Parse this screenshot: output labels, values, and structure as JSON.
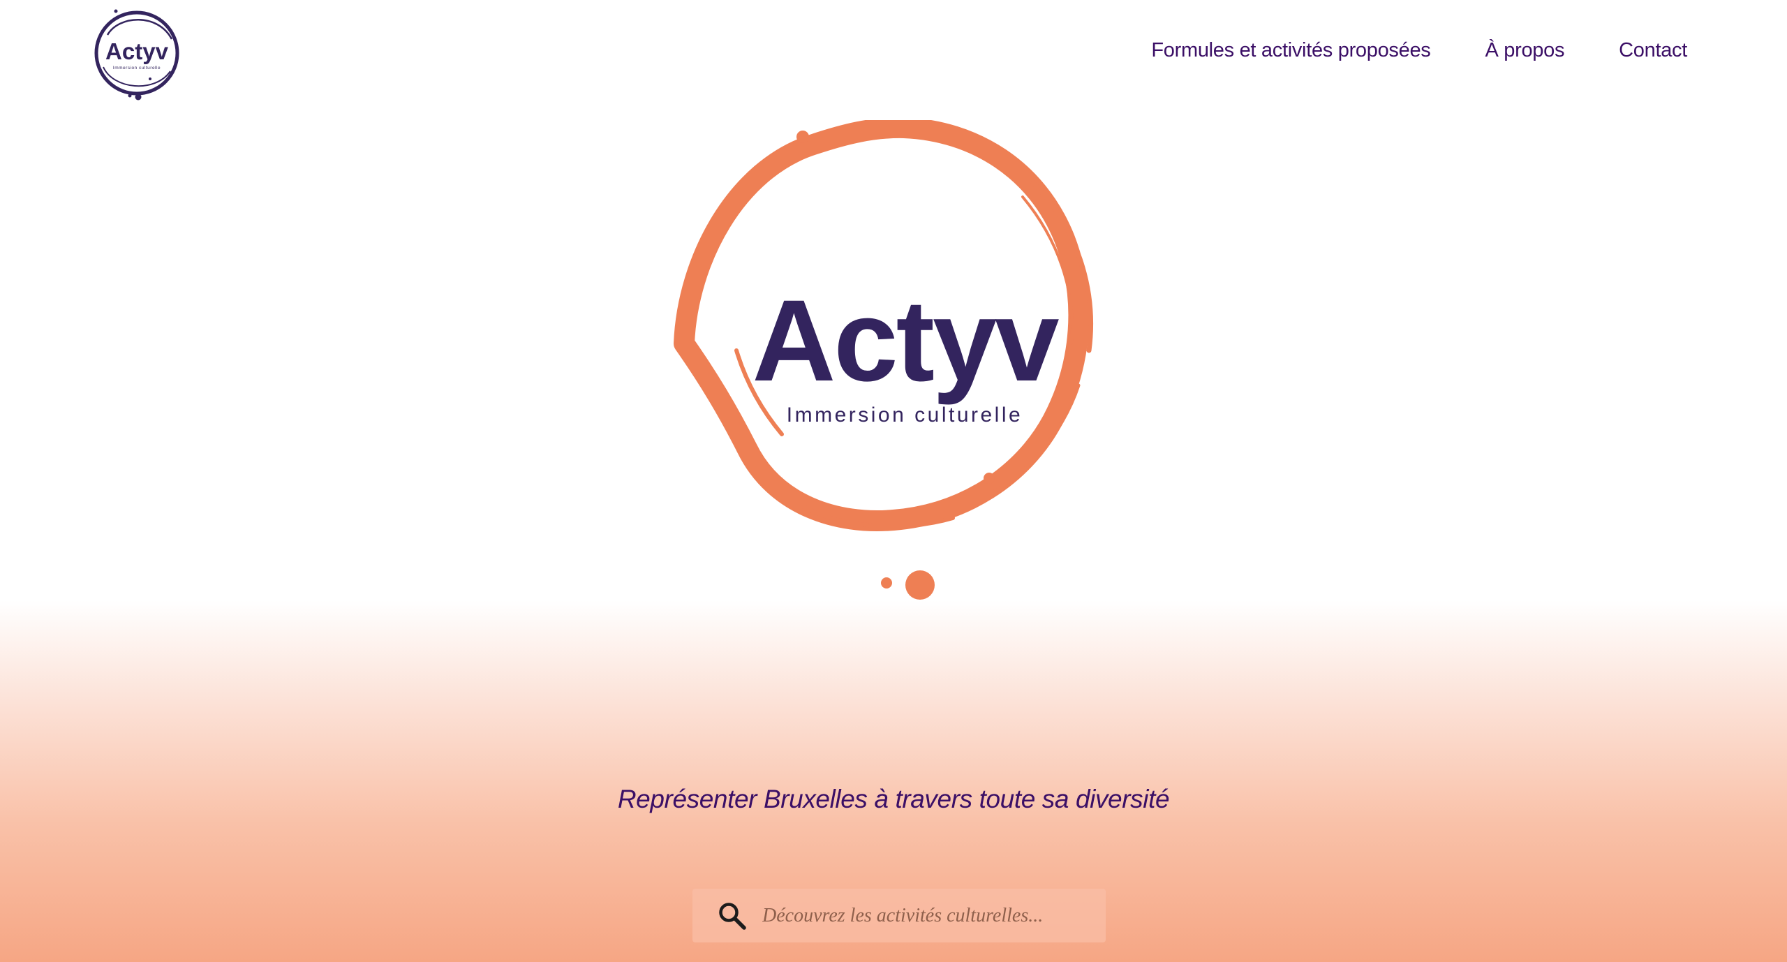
{
  "brand": {
    "logo_wordmark": "Actyv",
    "logo_subtitle": "Immersion culturelle",
    "logo_icon": "actyv-logo",
    "colors": {
      "primary": "#3b0f66",
      "logo_ink": "#33245e",
      "accent": "#ee7f54",
      "gradient_bottom": "#f6a684"
    }
  },
  "nav": {
    "items": [
      {
        "label": "Formules et activités proposées"
      },
      {
        "label": "À propos"
      },
      {
        "label": "Contact"
      }
    ]
  },
  "hero": {
    "tagline": "Représenter Bruxelles à travers toute sa diversité"
  },
  "search": {
    "icon": "search-icon",
    "placeholder": "Découvrez les activités culturelles...",
    "value": ""
  }
}
